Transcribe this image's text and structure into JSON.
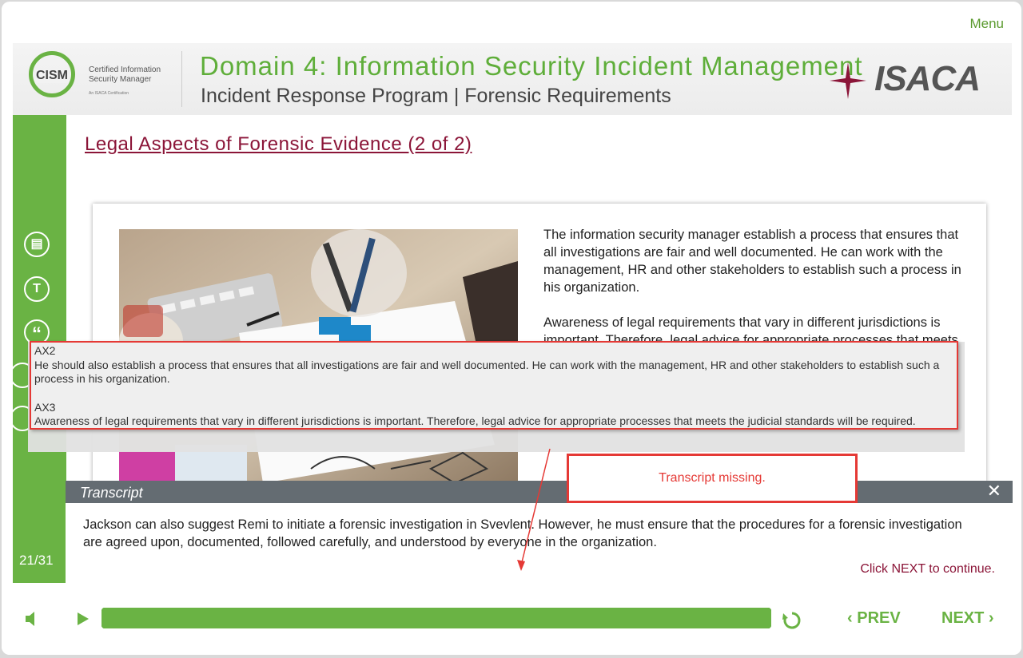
{
  "menu_label": "Menu",
  "header": {
    "cism_word": "CISM",
    "cism_line1": "Certified Information",
    "cism_line2": "Security Manager",
    "cism_tag": "An ISACA Certification",
    "domain_title": "Domain 4: Information Security Incident Management",
    "subtitle": "Incident Response Program | Forensic Requirements",
    "isaca_logo": "ISACA"
  },
  "sidebar": {
    "icons": [
      "notes-icon",
      "glossary-icon",
      "quote-icon"
    ],
    "icon_glyphs": [
      "▤",
      "T",
      "“"
    ],
    "page_counter": "21/31"
  },
  "slide": {
    "title": "Legal Aspects of Forensic Evidence (2 of 2)",
    "paragraph1": "The information security manager establish a process that ensures that all investigations are fair and well documented. He can work with the management, HR and other stakeholders to establish such a process in his organization.",
    "paragraph2": "Awareness of legal requirements that vary in different jurisdictions is important. Therefore, legal advice for appropriate processes that meets"
  },
  "annotation": {
    "ax2_label": "AX2",
    "ax2_text": "He should also establish a process that ensures that all investigations are fair and well documented. He can work with the management, HR and other stakeholders to establish such a process in his organization.",
    "ax3_label": "AX3",
    "ax3_text": "Awareness of legal requirements that vary in different jurisdictions is important. Therefore, legal advice for appropriate processes that meets the judicial standards will be required.",
    "missing_note": "Transcript missing.",
    "accent_color": "#e53935"
  },
  "transcript": {
    "label": "Transcript",
    "close_glyph": "✕",
    "text": "Jackson can also suggest Remi to initiate a forensic investigation in Svevlent. However, he must ensure that the procedures for a forensic investigation are agreed upon, documented, followed carefully, and understood by everyone in the organization.",
    "click_next": "Click NEXT to continue."
  },
  "controls": {
    "prev_label": "PREV",
    "next_label": "NEXT",
    "progress": 1.0,
    "brand_color": "#6ab344"
  }
}
